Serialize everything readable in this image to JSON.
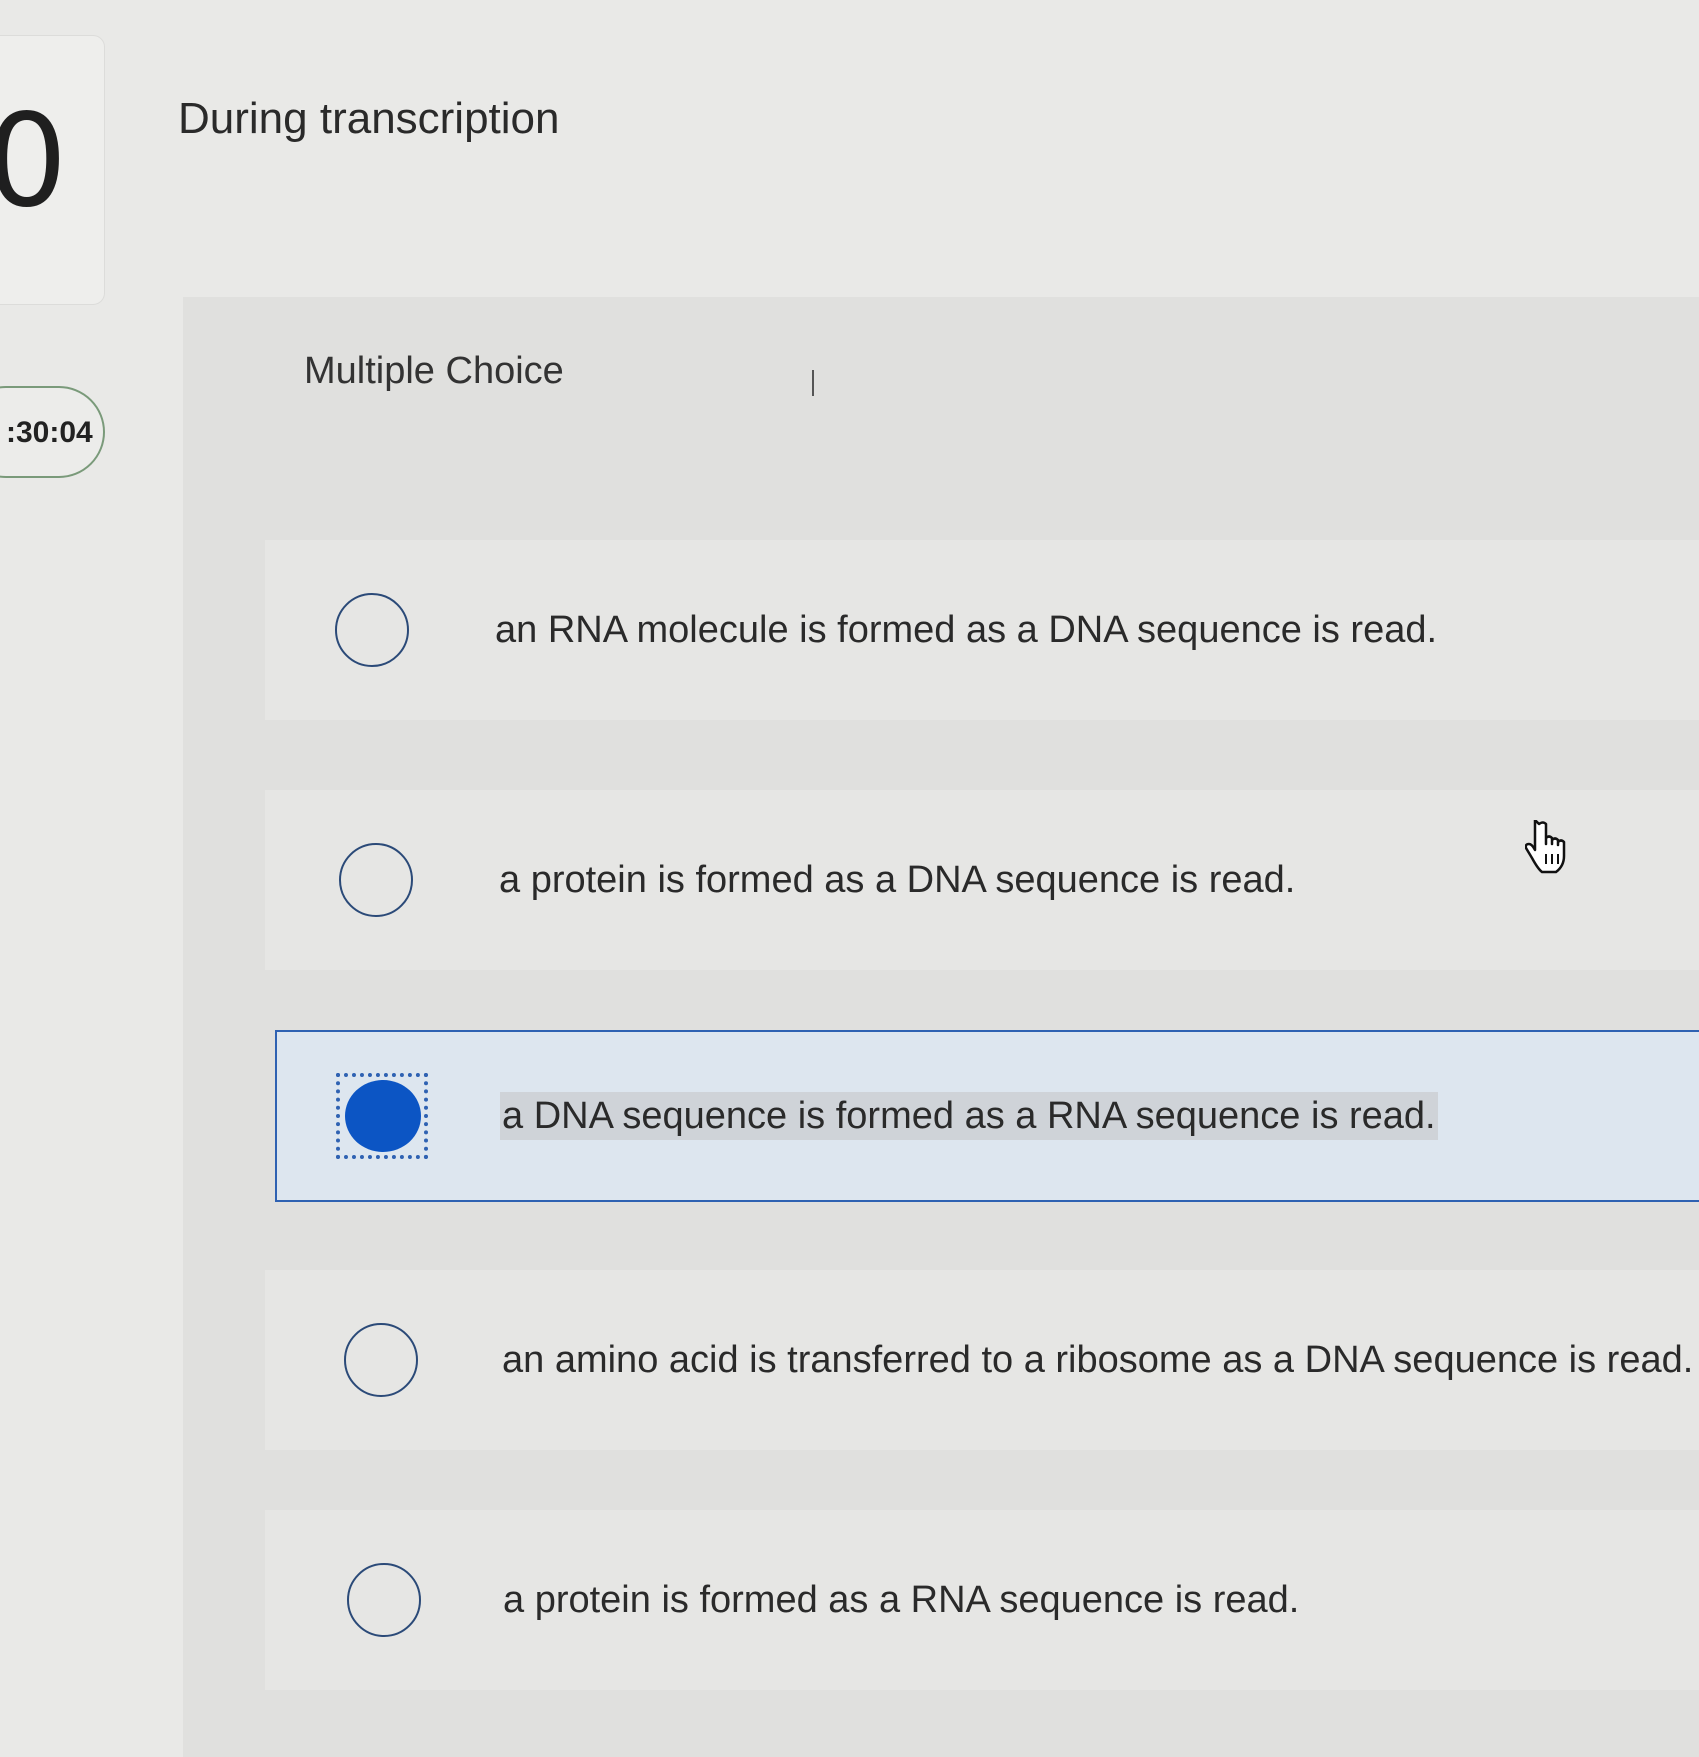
{
  "sidebar": {
    "question_number": "0",
    "timer": ":30:04"
  },
  "question": {
    "title": "During transcription",
    "type_label": "Multiple Choice",
    "options": [
      {
        "text": "an RNA molecule is formed as a DNA sequence is read.",
        "selected": false
      },
      {
        "text": "a protein is formed as a DNA sequence is read.",
        "selected": false
      },
      {
        "text": "a DNA sequence is formed as a RNA sequence is read.",
        "selected": true
      },
      {
        "text": "an amino acid is transferred to a ribosome as a DNA sequence is read.",
        "selected": false
      },
      {
        "text": "a protein is formed as a RNA sequence is read.",
        "selected": false
      }
    ]
  },
  "colors": {
    "accent": "#0c55c4",
    "selected_border": "#2f62b2",
    "selected_bg": "#dde6ef"
  },
  "icons": {
    "pointer": "hand-pointer-icon"
  }
}
